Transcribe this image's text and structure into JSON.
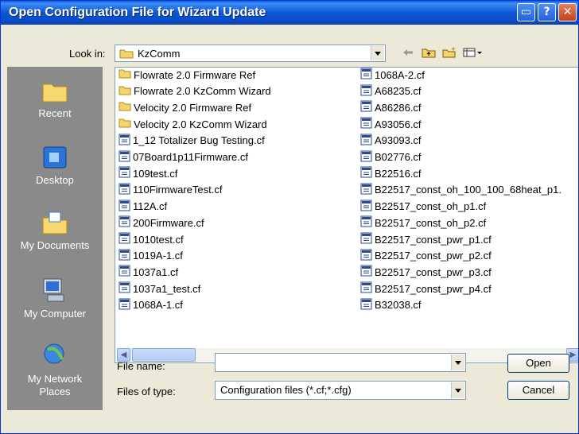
{
  "dialog": {
    "title": "Open Configuration File for Wizard Update"
  },
  "toolbar": {
    "look_in_label": "Look in:",
    "look_in_value": "KzComm",
    "icons": [
      "back-arrow-icon",
      "up-folder-icon",
      "new-folder-icon",
      "views-menu-icon"
    ]
  },
  "places": [
    {
      "label": "Recent",
      "icon": "recent-folder-icon"
    },
    {
      "label": "Desktop",
      "icon": "desktop-icon"
    },
    {
      "label": "My Documents",
      "icon": "my-documents-icon"
    },
    {
      "label": "My Computer",
      "icon": "my-computer-icon"
    },
    {
      "label": "My Network Places",
      "icon": "network-places-icon"
    }
  ],
  "files": {
    "column1": [
      {
        "name": "Flowrate 2.0 Firmware Ref",
        "type": "folder"
      },
      {
        "name": "Flowrate 2.0 KzComm Wizard",
        "type": "folder"
      },
      {
        "name": "Velocity 2.0 Firmware Ref",
        "type": "folder"
      },
      {
        "name": "Velocity 2.0 KzComm Wizard",
        "type": "folder"
      },
      {
        "name": "1_12 Totalizer Bug Testing.cf",
        "type": "file"
      },
      {
        "name": "07Board1p11Firmware.cf",
        "type": "file"
      },
      {
        "name": "109test.cf",
        "type": "file"
      },
      {
        "name": "110FirmwareTest.cf",
        "type": "file"
      },
      {
        "name": "112A.cf",
        "type": "file"
      },
      {
        "name": "200Firmware.cf",
        "type": "file"
      },
      {
        "name": "1010test.cf",
        "type": "file"
      },
      {
        "name": "1019A-1.cf",
        "type": "file"
      },
      {
        "name": "1037a1.cf",
        "type": "file"
      },
      {
        "name": "1037a1_test.cf",
        "type": "file"
      },
      {
        "name": "1068A-1.cf",
        "type": "file"
      }
    ],
    "column2": [
      {
        "name": "1068A-2.cf",
        "type": "file"
      },
      {
        "name": "A68235.cf",
        "type": "file"
      },
      {
        "name": "A86286.cf",
        "type": "file"
      },
      {
        "name": "A93056.cf",
        "type": "file"
      },
      {
        "name": "A93093.cf",
        "type": "file"
      },
      {
        "name": "B02776.cf",
        "type": "file"
      },
      {
        "name": "B22516.cf",
        "type": "file"
      },
      {
        "name": "B22517_const_oh_100_100_68heat_p1.",
        "type": "file"
      },
      {
        "name": "B22517_const_oh_p1.cf",
        "type": "file"
      },
      {
        "name": "B22517_const_oh_p2.cf",
        "type": "file"
      },
      {
        "name": "B22517_const_pwr_p1.cf",
        "type": "file"
      },
      {
        "name": "B22517_const_pwr_p2.cf",
        "type": "file"
      },
      {
        "name": "B22517_const_pwr_p3.cf",
        "type": "file"
      },
      {
        "name": "B22517_const_pwr_p4.cf",
        "type": "file"
      },
      {
        "name": "B32038.cf",
        "type": "file"
      }
    ]
  },
  "bottom": {
    "file_name_label": "File name:",
    "file_name_value": "",
    "files_of_type_label": "Files of type:",
    "files_of_type_value": "Configuration files (*.cf;*.cfg)",
    "open_label": "Open",
    "cancel_label": "Cancel"
  }
}
